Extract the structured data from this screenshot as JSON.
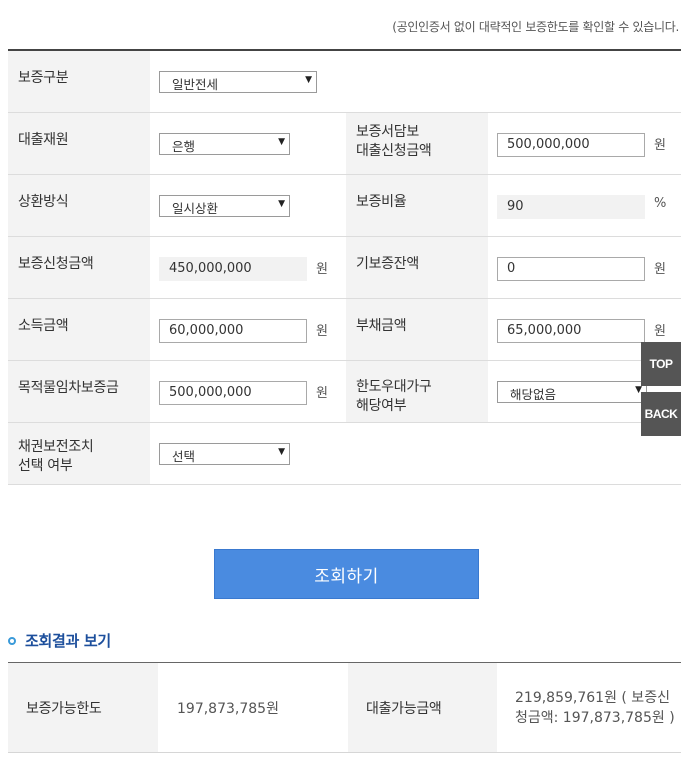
{
  "note": "(공인인증서 없이 대략적인 보증한도를 확인할 수 있습니다.",
  "rows": [
    {
      "label": "보증구분",
      "select": "일반전세"
    },
    {
      "label": "대출재원",
      "select": "은행",
      "label2": "보증서담보\n대출신청금액",
      "input2": "500,000,000",
      "unit2": "원"
    },
    {
      "label": "상환방식",
      "select": "일시상환",
      "label2": "보증비율",
      "input2": "90",
      "unit2": "%"
    },
    {
      "label": "보증신청금액",
      "input": "450,000,000",
      "unit": "원",
      "label2": "기보증잔액",
      "input2": "0",
      "unit2": "원"
    },
    {
      "label": "소득금액",
      "input": "60,000,000",
      "unit": "원",
      "label2": "부채금액",
      "input2": "65,000,000",
      "unit2": "원"
    },
    {
      "label": "목적물임차보증금",
      "input": "500,000,000",
      "unit": "원",
      "label2": "한도우대가구\n해당여부",
      "select2": "해당없음"
    },
    {
      "label": "채권보전조치\n선택 여부",
      "select": "선택"
    }
  ],
  "side_buttons": {
    "top": "TOP",
    "back": "BACK"
  },
  "search_button": "조회하기",
  "result_title": "조회결과 보기",
  "result": {
    "limit_label": "보증가능한도",
    "limit_value": "197,873,785원",
    "loan_label": "대출가능금액",
    "loan_value": "219,859,761원 ( 보증신청금액: 197,873,785원 )"
  }
}
